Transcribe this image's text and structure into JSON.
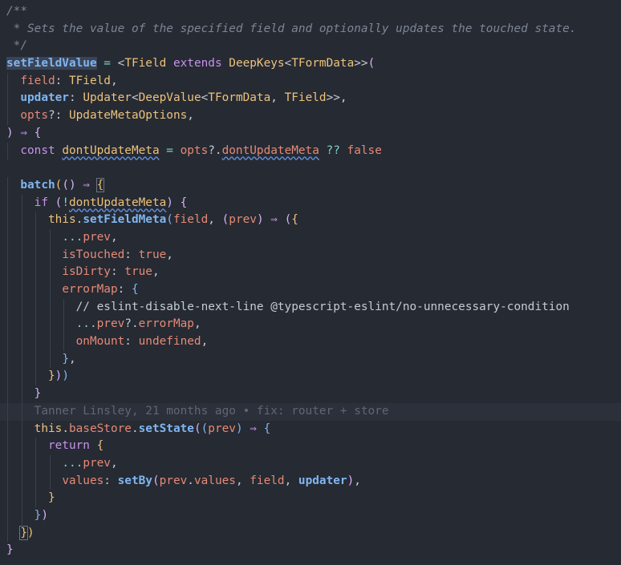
{
  "editor": {
    "lines": [
      {
        "indent": 0,
        "tokens": [
          {
            "t": "/**",
            "c": "comment"
          }
        ]
      },
      {
        "indent": 0,
        "tokens": [
          {
            "t": " * Sets the value of the specified field and optionally updates the touched state.",
            "c": "comment"
          }
        ]
      },
      {
        "indent": 0,
        "tokens": [
          {
            "t": " */",
            "c": "comment"
          }
        ]
      },
      {
        "indent": 0,
        "tokens": [
          {
            "t": "setFieldValue",
            "c": "fndecl"
          },
          {
            "t": " = ",
            "c": "op"
          },
          {
            "t": "<",
            "c": "punct"
          },
          {
            "t": "TField",
            "c": "type"
          },
          {
            "t": " extends ",
            "c": "kw"
          },
          {
            "t": "DeepKeys",
            "c": "type"
          },
          {
            "t": "<",
            "c": "punct"
          },
          {
            "t": "TFormData",
            "c": "type"
          },
          {
            "t": ">>",
            "c": "punct"
          },
          {
            "t": "(",
            "c": "bracket"
          }
        ]
      },
      {
        "indent": 1,
        "tokens": [
          {
            "t": "field",
            "c": "prop"
          },
          {
            "t": ": ",
            "c": "punct"
          },
          {
            "t": "TField",
            "c": "type"
          },
          {
            "t": ",",
            "c": "punct"
          }
        ]
      },
      {
        "indent": 1,
        "tokens": [
          {
            "t": "updater",
            "c": "fnb"
          },
          {
            "t": ": ",
            "c": "punct"
          },
          {
            "t": "Updater",
            "c": "type"
          },
          {
            "t": "<",
            "c": "punct"
          },
          {
            "t": "DeepValue",
            "c": "type"
          },
          {
            "t": "<",
            "c": "punct"
          },
          {
            "t": "TFormData",
            "c": "type"
          },
          {
            "t": ", ",
            "c": "punct"
          },
          {
            "t": "TField",
            "c": "type"
          },
          {
            "t": ">>",
            "c": "punct"
          },
          {
            "t": ",",
            "c": "punct"
          }
        ]
      },
      {
        "indent": 1,
        "tokens": [
          {
            "t": "opts",
            "c": "prop"
          },
          {
            "t": "?: ",
            "c": "punct"
          },
          {
            "t": "UpdateMetaOptions",
            "c": "type"
          },
          {
            "t": ",",
            "c": "punct"
          }
        ]
      },
      {
        "indent": 0,
        "tokens": [
          {
            "t": ")",
            "c": "bracket"
          },
          {
            "t": " ⇒ ",
            "c": "arrow"
          },
          {
            "t": "{",
            "c": "bracket"
          }
        ]
      },
      {
        "indent": 1,
        "tokens": [
          {
            "t": "const ",
            "c": "kw"
          },
          {
            "t": "dontUpdateMeta",
            "c": "type",
            "sq": true
          },
          {
            "t": " = ",
            "c": "op"
          },
          {
            "t": "opts",
            "c": "prop"
          },
          {
            "t": "?.",
            "c": "punct"
          },
          {
            "t": "dontUpdateMeta",
            "c": "prop",
            "sq": true
          },
          {
            "t": " ?? ",
            "c": "op"
          },
          {
            "t": "false",
            "c": "const"
          }
        ]
      },
      {
        "indent": 0,
        "tokens": []
      },
      {
        "indent": 1,
        "tokens": [
          {
            "t": "batch",
            "c": "fnb"
          },
          {
            "t": "(",
            "c": "bracket-y"
          },
          {
            "t": "()",
            "c": "bracket"
          },
          {
            "t": " ⇒ ",
            "c": "arrow"
          },
          {
            "t": "{",
            "c": "bracket-y",
            "match": true
          }
        ]
      },
      {
        "indent": 2,
        "tokens": [
          {
            "t": "if ",
            "c": "kw"
          },
          {
            "t": "(",
            "c": "bracket"
          },
          {
            "t": "!",
            "c": "op"
          },
          {
            "t": "dontUpdateMeta",
            "c": "type",
            "sq": true
          },
          {
            "t": ") ",
            "c": "bracket"
          },
          {
            "t": "{",
            "c": "bracket"
          }
        ]
      },
      {
        "indent": 3,
        "tokens": [
          {
            "t": "this",
            "c": "this"
          },
          {
            "t": ".",
            "c": "punct"
          },
          {
            "t": "setFieldMeta",
            "c": "fnb"
          },
          {
            "t": "(",
            "c": "bracket-b"
          },
          {
            "t": "field",
            "c": "prop"
          },
          {
            "t": ", ",
            "c": "punct"
          },
          {
            "t": "(",
            "c": "bracket"
          },
          {
            "t": "prev",
            "c": "prop"
          },
          {
            "t": ")",
            "c": "bracket"
          },
          {
            "t": " ⇒ ",
            "c": "arrow"
          },
          {
            "t": "(",
            "c": "bracket"
          },
          {
            "t": "{",
            "c": "bracket-y"
          }
        ]
      },
      {
        "indent": 4,
        "tokens": [
          {
            "t": "...",
            "c": "op"
          },
          {
            "t": "prev",
            "c": "prop"
          },
          {
            "t": ",",
            "c": "punct"
          }
        ]
      },
      {
        "indent": 4,
        "tokens": [
          {
            "t": "isTouched",
            "c": "prop"
          },
          {
            "t": ": ",
            "c": "punct"
          },
          {
            "t": "true",
            "c": "const"
          },
          {
            "t": ",",
            "c": "punct"
          }
        ]
      },
      {
        "indent": 4,
        "tokens": [
          {
            "t": "isDirty",
            "c": "prop"
          },
          {
            "t": ": ",
            "c": "punct"
          },
          {
            "t": "true",
            "c": "const"
          },
          {
            "t": ",",
            "c": "punct"
          }
        ]
      },
      {
        "indent": 4,
        "tokens": [
          {
            "t": "errorMap",
            "c": "prop"
          },
          {
            "t": ": ",
            "c": "punct"
          },
          {
            "t": "{",
            "c": "bracket-b"
          }
        ]
      },
      {
        "indent": 5,
        "tokens": [
          {
            "t": "// eslint-disable-next-line @typescript-eslint/no-unnecessary-condition",
            "c": "plain"
          }
        ]
      },
      {
        "indent": 5,
        "tokens": [
          {
            "t": "...",
            "c": "op"
          },
          {
            "t": "prev",
            "c": "prop"
          },
          {
            "t": "?.",
            "c": "punct"
          },
          {
            "t": "errorMap",
            "c": "prop"
          },
          {
            "t": ",",
            "c": "punct"
          }
        ]
      },
      {
        "indent": 5,
        "tokens": [
          {
            "t": "onMount",
            "c": "prop"
          },
          {
            "t": ": ",
            "c": "punct"
          },
          {
            "t": "undefined",
            "c": "const"
          },
          {
            "t": ",",
            "c": "punct"
          }
        ]
      },
      {
        "indent": 4,
        "tokens": [
          {
            "t": "}",
            "c": "bracket-b"
          },
          {
            "t": ",",
            "c": "punct"
          }
        ]
      },
      {
        "indent": 3,
        "tokens": [
          {
            "t": "}",
            "c": "bracket-y"
          },
          {
            "t": ")",
            "c": "bracket"
          },
          {
            "t": ")",
            "c": "bracket-b"
          }
        ]
      },
      {
        "indent": 2,
        "tokens": [
          {
            "t": "}",
            "c": "bracket"
          }
        ]
      },
      {
        "indent": 2,
        "current": true,
        "tokens": [
          {
            "t": "Tanner Linsley, 21 months ago • fix: router + store",
            "c": "blame"
          }
        ]
      },
      {
        "indent": 2,
        "tokens": [
          {
            "t": "this",
            "c": "this"
          },
          {
            "t": ".",
            "c": "punct"
          },
          {
            "t": "baseStore",
            "c": "prop"
          },
          {
            "t": ".",
            "c": "punct"
          },
          {
            "t": "setState",
            "c": "fnb"
          },
          {
            "t": "(",
            "c": "bracket"
          },
          {
            "t": "(",
            "c": "bracket-b"
          },
          {
            "t": "prev",
            "c": "prop"
          },
          {
            "t": ")",
            "c": "bracket-b"
          },
          {
            "t": " ⇒ ",
            "c": "arrow"
          },
          {
            "t": "{",
            "c": "bracket-b"
          }
        ]
      },
      {
        "indent": 3,
        "tokens": [
          {
            "t": "return ",
            "c": "kw"
          },
          {
            "t": "{",
            "c": "bracket-y"
          }
        ]
      },
      {
        "indent": 4,
        "tokens": [
          {
            "t": "...",
            "c": "op"
          },
          {
            "t": "prev",
            "c": "prop"
          },
          {
            "t": ",",
            "c": "punct"
          }
        ]
      },
      {
        "indent": 4,
        "tokens": [
          {
            "t": "values",
            "c": "prop"
          },
          {
            "t": ": ",
            "c": "punct"
          },
          {
            "t": "setBy",
            "c": "fnb"
          },
          {
            "t": "(",
            "c": "bracket"
          },
          {
            "t": "prev",
            "c": "prop"
          },
          {
            "t": ".",
            "c": "punct"
          },
          {
            "t": "values",
            "c": "prop"
          },
          {
            "t": ", ",
            "c": "punct"
          },
          {
            "t": "field",
            "c": "prop"
          },
          {
            "t": ", ",
            "c": "punct"
          },
          {
            "t": "updater",
            "c": "fnb"
          },
          {
            "t": ")",
            "c": "bracket"
          },
          {
            "t": ",",
            "c": "punct"
          }
        ]
      },
      {
        "indent": 3,
        "tokens": [
          {
            "t": "}",
            "c": "bracket-y"
          }
        ]
      },
      {
        "indent": 2,
        "tokens": [
          {
            "t": "}",
            "c": "bracket-b"
          },
          {
            "t": ")",
            "c": "bracket"
          }
        ]
      },
      {
        "indent": 1,
        "tokens": [
          {
            "t": "}",
            "c": "bracket-y",
            "match": true
          },
          {
            "t": ")",
            "c": "bracket-y"
          }
        ]
      },
      {
        "indent": 0,
        "tokens": [
          {
            "t": "}",
            "c": "bracket"
          }
        ]
      }
    ]
  }
}
